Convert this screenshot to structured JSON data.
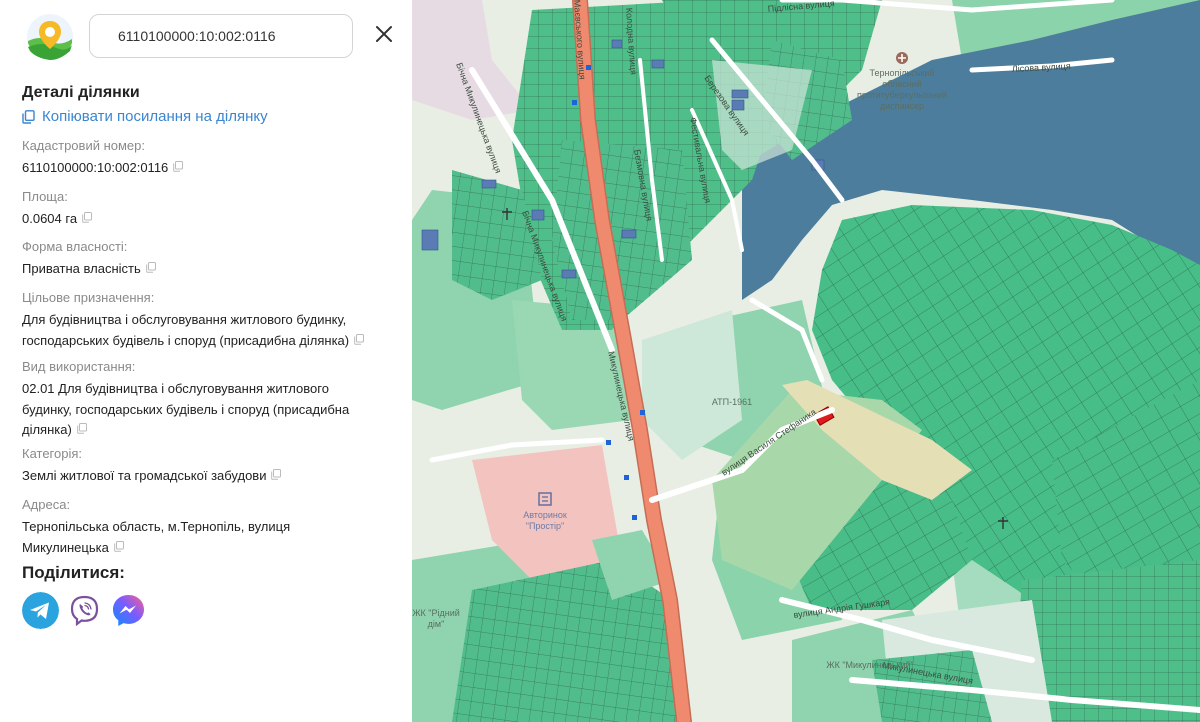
{
  "search": {
    "value": "6110100000:10:002:0116"
  },
  "details": {
    "title": "Деталі ділянки",
    "copy_link_label": "Копіювати посилання на ділянку",
    "fields": [
      {
        "label": "Кадастровий номер:",
        "value": "6110100000:10:002:0116"
      },
      {
        "label": "Площа:",
        "value": "0.0604 га"
      },
      {
        "label": "Форма власності:",
        "value": "Приватна власність"
      },
      {
        "label": "Цільове призначення:",
        "value_lines": [
          "Для будівництва і обслуговування житлового будинку,",
          "господарських будівель і споруд (присадибна ділянка)"
        ]
      },
      {
        "label": "Вид використання:",
        "value_lines": [
          "02.01 Для будівництва і обслуговування житлового",
          "будинку, господарських будівель і споруд (присадибна",
          "ділянка)"
        ]
      },
      {
        "label": "Категорія:",
        "value": "Землі житлової та громадської забудови"
      },
      {
        "label": "Адреса:",
        "value_lines": [
          "Тернопільська область, м.Тернопіль, вулиця",
          "Микулинецька"
        ]
      }
    ]
  },
  "share": {
    "title": "Поділитися:",
    "buttons": [
      {
        "icon": "telegram-icon",
        "color": "#2aa3df"
      },
      {
        "icon": "viber-icon",
        "color": "#7b519d"
      },
      {
        "icon": "messenger-icon",
        "color": "#7a5cff"
      }
    ]
  },
  "map": {
    "colors": {
      "water": "#4d7d9c",
      "parcel": "#47be88",
      "parcel_dark": "#5a7bb4",
      "selected": "#e01b1b",
      "road_main": "#f08a6e",
      "background": "#eef1ea"
    },
    "street_labels": {
      "a": "Микулинецька вулиця",
      "b": "вулиця Василя Стефаника",
      "c": "вулиця Андрія Гушкаря",
      "d": "Микулинецька вулиця",
      "e": "Підлісна вулиця",
      "f": "Лісова вулиця",
      "g": "Фестивальна вулиця",
      "h": "Березова вулиця",
      "i": "Безмовна вулиця",
      "j": "Бічна Микулинецька вулиця",
      "k": "Бічна Микулинецька вулиця",
      "l": "Маєвського вулиця",
      "m": "Колодна вулиця"
    },
    "poi_labels": {
      "hospital_1": "Тернопільський",
      "hospital_2": "обласний",
      "hospital_3": "протитуберкульозний",
      "hospital_4": "диспансер",
      "market_1": "Авторинок",
      "market_2": "\"Простір\"",
      "atp": "АТП-1961",
      "res1_1": "ЖК \"Рідний",
      "res1_2": "дім\"",
      "res2": "ЖК \"Микулинецький\""
    }
  }
}
